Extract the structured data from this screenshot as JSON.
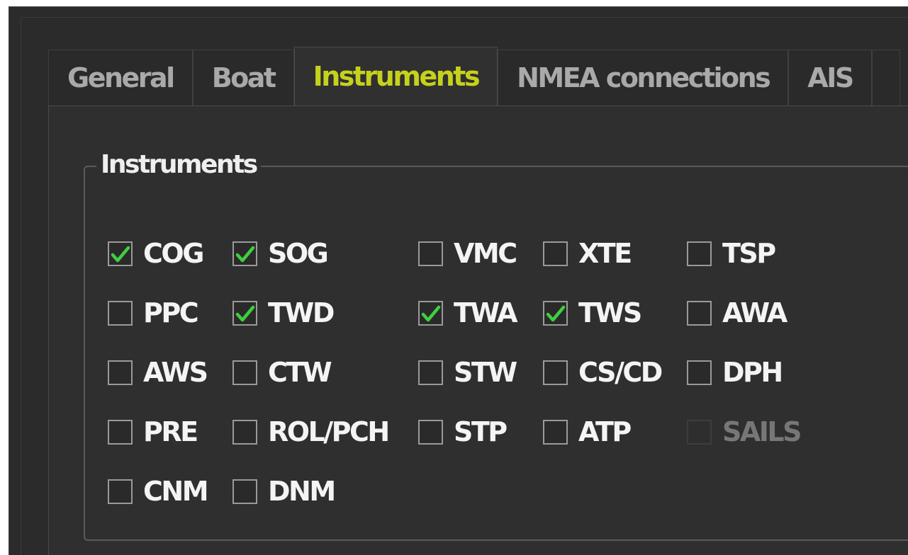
{
  "tabs": [
    {
      "label": "General",
      "active": false
    },
    {
      "label": "Boat",
      "active": false
    },
    {
      "label": "Instruments",
      "active": true
    },
    {
      "label": "NMEA connections",
      "active": false
    },
    {
      "label": "AIS",
      "active": false
    },
    {
      "label": "",
      "active": false
    }
  ],
  "group": {
    "title": "Instruments"
  },
  "instruments": [
    {
      "label": "COG",
      "checked": true,
      "enabled": true
    },
    {
      "label": "SOG",
      "checked": true,
      "enabled": true
    },
    {
      "label": "VMC",
      "checked": false,
      "enabled": true
    },
    {
      "label": "XTE",
      "checked": false,
      "enabled": true
    },
    {
      "label": "TSP",
      "checked": false,
      "enabled": true
    },
    {
      "label": "PPC",
      "checked": false,
      "enabled": true
    },
    {
      "label": "TWD",
      "checked": true,
      "enabled": true
    },
    {
      "label": "TWA",
      "checked": true,
      "enabled": true
    },
    {
      "label": "TWS",
      "checked": true,
      "enabled": true
    },
    {
      "label": "AWA",
      "checked": false,
      "enabled": true
    },
    {
      "label": "AWS",
      "checked": false,
      "enabled": true
    },
    {
      "label": "CTW",
      "checked": false,
      "enabled": true
    },
    {
      "label": "STW",
      "checked": false,
      "enabled": true
    },
    {
      "label": "CS/CD",
      "checked": false,
      "enabled": true
    },
    {
      "label": "DPH",
      "checked": false,
      "enabled": true
    },
    {
      "label": "PRE",
      "checked": false,
      "enabled": true
    },
    {
      "label": "ROL/PCH",
      "checked": false,
      "enabled": true
    },
    {
      "label": "STP",
      "checked": false,
      "enabled": true
    },
    {
      "label": "ATP",
      "checked": false,
      "enabled": true
    },
    {
      "label": "SAILS",
      "checked": false,
      "enabled": false
    },
    {
      "label": "CNM",
      "checked": false,
      "enabled": true
    },
    {
      "label": "DNM",
      "checked": false,
      "enabled": true
    }
  ],
  "colors": {
    "active_tab_text": "#c6d11c",
    "check_mark": "#3fcf3f",
    "background": "#2f2f2f"
  }
}
